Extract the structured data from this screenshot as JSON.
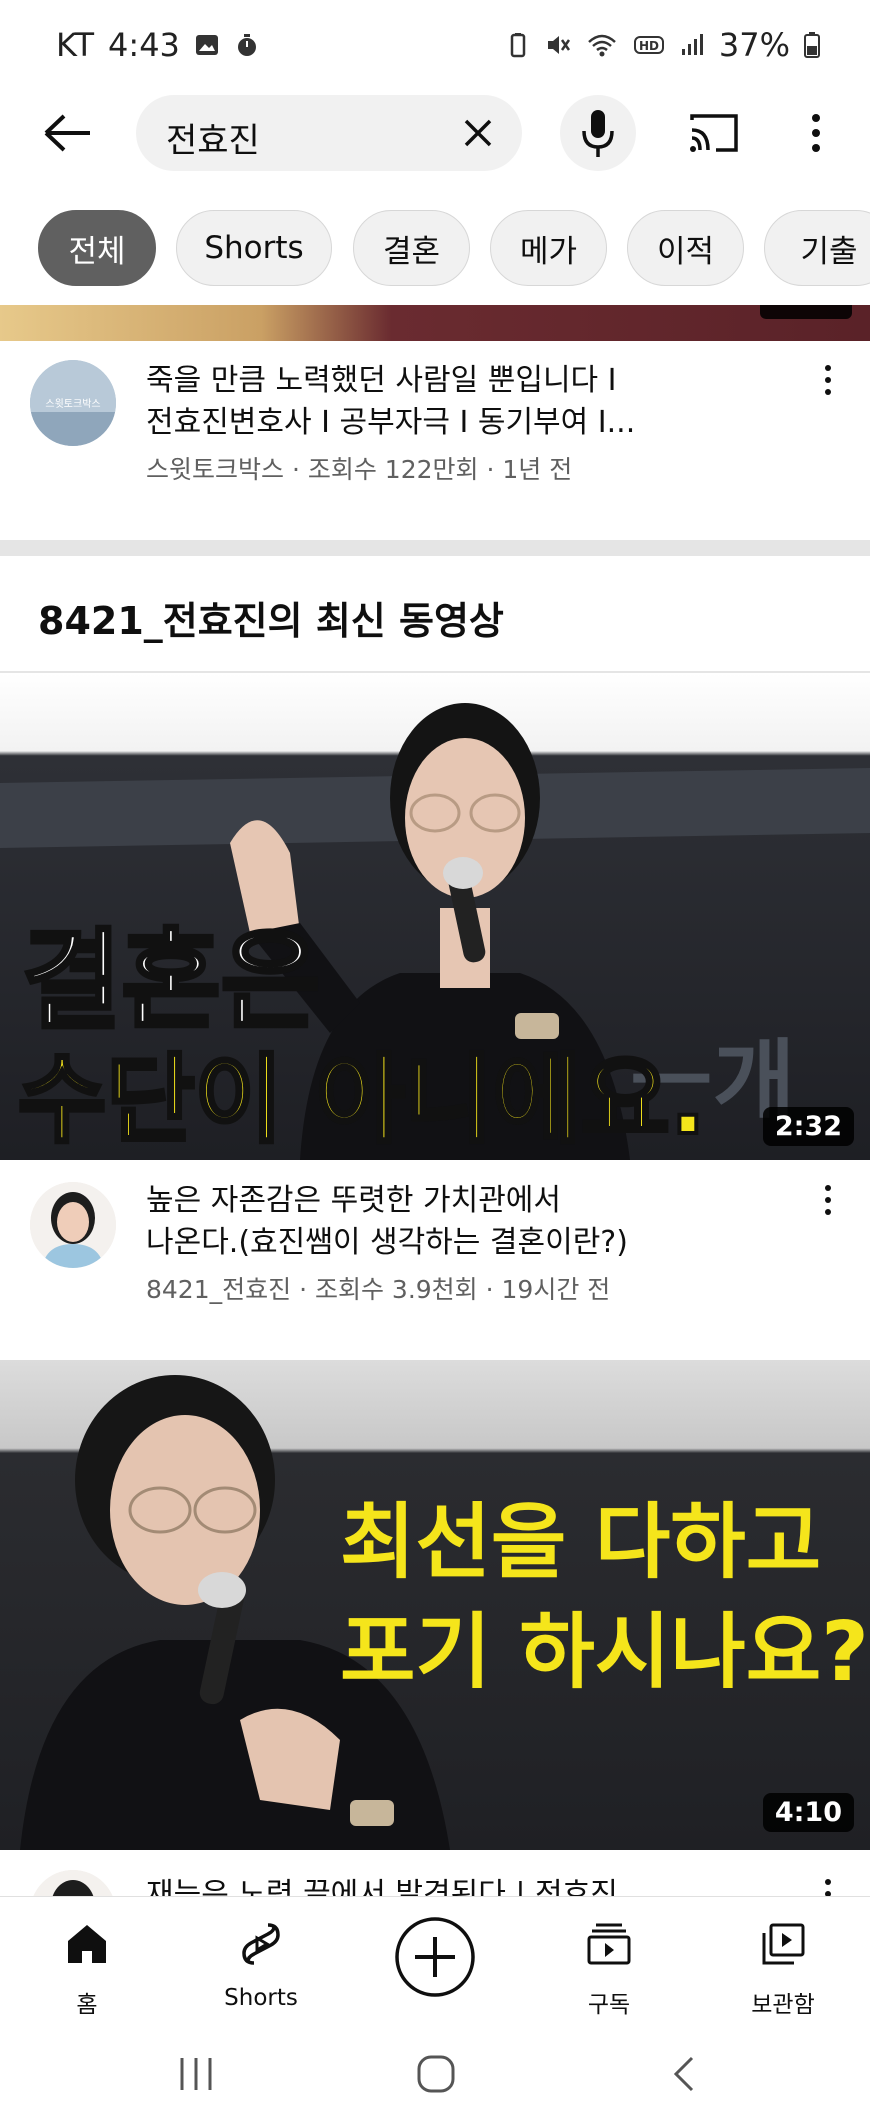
{
  "status_bar": {
    "carrier": "KT",
    "time": "4:43",
    "battery": "37%"
  },
  "search": {
    "query": "전효진"
  },
  "chips": [
    {
      "label": "전체",
      "active": true
    },
    {
      "label": "Shorts",
      "active": false
    },
    {
      "label": "결혼",
      "active": false
    },
    {
      "label": "메가",
      "active": false
    },
    {
      "label": "이적",
      "active": false
    },
    {
      "label": "기출",
      "active": false
    }
  ],
  "video1": {
    "title_line1": "죽을 만큼 노력했던 사람일 뿐입니다 I",
    "title_line2": "전효진변호사 I 공부자극 I 동기부여 I...",
    "meta": "스윗토크박스 · 조회수 122만회 · 1년 전",
    "avatar_text": "스윗토크박스"
  },
  "section": {
    "title": "8421_전효진의 최신 동영상"
  },
  "video2": {
    "thumb_line1": "결혼은",
    "thumb_line2": "수단이 아니에요.",
    "duration": "2:32",
    "title_line1": "높은 자존감은 뚜렷한 가치관에서",
    "title_line2": "나온다.(효진쌤이 생각하는 결혼이란?)",
    "meta": "8421_전효진 · 조회수 3.9천회 · 19시간 전"
  },
  "video3": {
    "thumb_line1": "최선을 다하고",
    "thumb_line2": "포기 하시나요?",
    "duration": "4:10",
    "title_partial": "재능은 노력 끝에서 발견된다 | 전효진"
  },
  "bottom_nav": {
    "home": "홈",
    "shorts": "Shorts",
    "subscriptions": "구독",
    "library": "보관함"
  },
  "colors": {
    "accent_yellow": "#f5e51b",
    "chip_active": "#606060",
    "meta_gray": "#606060"
  }
}
